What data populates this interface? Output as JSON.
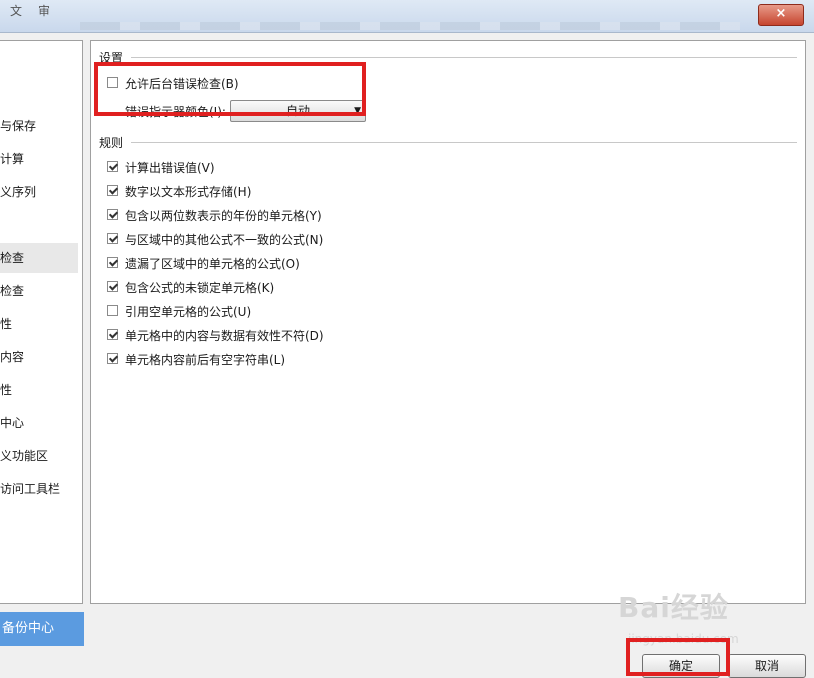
{
  "titlebar": {
    "ghost_a": "文",
    "ghost_b": "审",
    "close": "×"
  },
  "leftnav": {
    "items": [
      {
        "label": "与保存",
        "top": 0
      },
      {
        "label": "计算",
        "top": 0
      },
      {
        "label": "义序列",
        "top": 0
      },
      {
        "label": "检查",
        "active": true
      },
      {
        "label": "检查"
      },
      {
        "label": "性"
      },
      {
        "label": "内容"
      },
      {
        "label": "性"
      },
      {
        "label": "中心"
      },
      {
        "label": "义功能区"
      },
      {
        "label": "访问工具栏"
      }
    ],
    "backup": "备份中心"
  },
  "settings": {
    "title": "设置",
    "background_check": {
      "label": "允许后台错误检查(B)",
      "checked": false
    },
    "indicator_label": "错误指示器颜色(I):",
    "indicator_value": "自动"
  },
  "rules": {
    "title": "规则",
    "items": [
      {
        "label": "计算出错误值(V)",
        "checked": true
      },
      {
        "label": "数字以文本形式存储(H)",
        "checked": true
      },
      {
        "label": "包含以两位数表示的年份的单元格(Y)",
        "checked": true
      },
      {
        "label": "与区域中的其他公式不一致的公式(N)",
        "checked": true
      },
      {
        "label": "遗漏了区域中的单元格的公式(O)",
        "checked": true
      },
      {
        "label": "包含公式的未锁定单元格(K)",
        "checked": true
      },
      {
        "label": "引用空单元格的公式(U)",
        "checked": false
      },
      {
        "label": "单元格中的内容与数据有效性不符(D)",
        "checked": true
      },
      {
        "label": "单元格内容前后有空字符串(L)",
        "checked": true
      }
    ]
  },
  "buttons": {
    "ok": "确定",
    "cancel": "取消"
  },
  "watermark": {
    "brand": "Bai经验",
    "url": "jingyan.baidu.com"
  },
  "colors": {
    "highlight": "#e02020",
    "backup_bg": "#5b9be0"
  }
}
